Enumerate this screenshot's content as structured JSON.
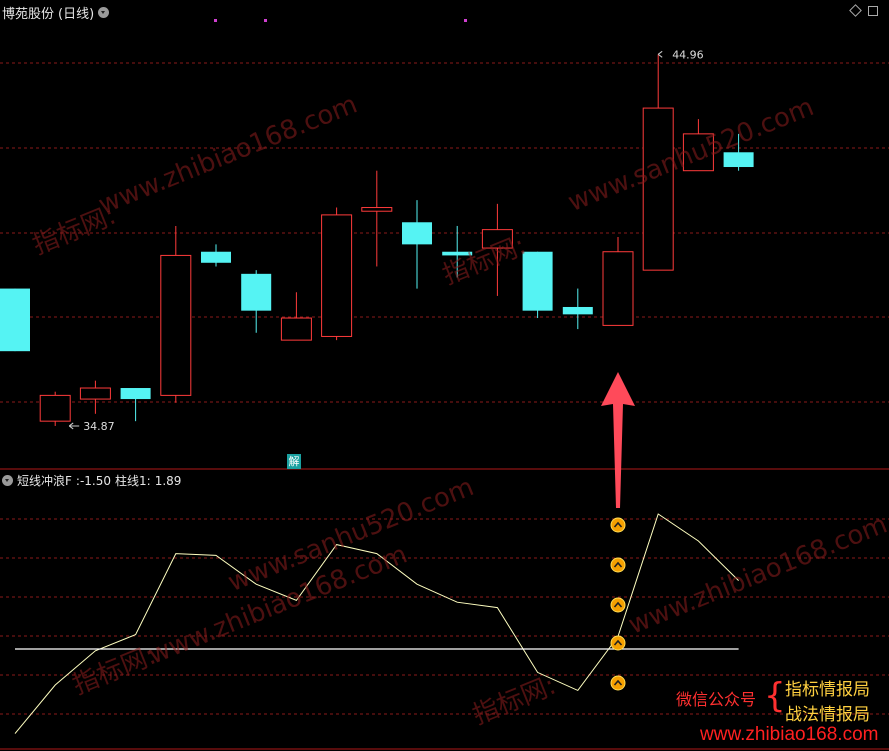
{
  "header": {
    "stock_name": "博苑股份",
    "period": "(日线)"
  },
  "indicator": {
    "label": "短线冲浪F",
    "value_text": ":-1.50",
    "bar_label": "柱线1:",
    "bar_value": "1.89"
  },
  "markers": {
    "high": "44.96",
    "low": "34.87",
    "jie": "解"
  },
  "watermark": {
    "cn": "指标网:",
    "url": "www.zhibiao168.com",
    "alt_url": "www.sanhu520.com"
  },
  "footer": {
    "wechat_label": "微信公众号",
    "brand1": "指标情报局",
    "brand2": "战法情报局",
    "site": "www.zhibiao168.com"
  },
  "colors": {
    "up": "#ff3b3b",
    "down": "#55f3f3",
    "grid": "#8a1a1a",
    "line": "#ffffc0",
    "baseline": "#ffffff"
  },
  "chart_data": {
    "type": "candlestick",
    "candles": [
      {
        "o": 38.6,
        "h": 38.6,
        "l": 36.9,
        "c": 36.9
      },
      {
        "o": 35.0,
        "h": 35.8,
        "l": 34.87,
        "c": 35.7
      },
      {
        "o": 35.6,
        "h": 36.1,
        "l": 35.2,
        "c": 35.9
      },
      {
        "o": 35.9,
        "h": 35.9,
        "l": 35.0,
        "c": 35.6
      },
      {
        "o": 35.7,
        "h": 40.3,
        "l": 35.5,
        "c": 39.5
      },
      {
        "o": 39.6,
        "h": 39.8,
        "l": 39.2,
        "c": 39.3
      },
      {
        "o": 39.0,
        "h": 39.1,
        "l": 37.4,
        "c": 38.0
      },
      {
        "o": 37.2,
        "h": 38.5,
        "l": 37.2,
        "c": 37.8
      },
      {
        "o": 37.3,
        "h": 40.8,
        "l": 37.2,
        "c": 40.6
      },
      {
        "o": 40.7,
        "h": 41.8,
        "l": 39.2,
        "c": 40.8
      },
      {
        "o": 40.4,
        "h": 41.0,
        "l": 38.6,
        "c": 39.8
      },
      {
        "o": 39.6,
        "h": 40.3,
        "l": 38.9,
        "c": 39.5
      },
      {
        "o": 39.7,
        "h": 40.9,
        "l": 38.4,
        "c": 40.2
      },
      {
        "o": 39.6,
        "h": 39.6,
        "l": 37.8,
        "c": 38.0
      },
      {
        "o": 38.1,
        "h": 38.6,
        "l": 37.5,
        "c": 37.9
      },
      {
        "o": 37.6,
        "h": 40.0,
        "l": 37.6,
        "c": 39.6
      },
      {
        "o": 39.1,
        "h": 44.96,
        "l": 39.1,
        "c": 43.5
      },
      {
        "o": 41.8,
        "h": 43.2,
        "l": 41.8,
        "c": 42.8
      },
      {
        "o": 42.3,
        "h": 42.8,
        "l": 41.8,
        "c": 41.9
      }
    ],
    "indicator_series": [
      -6.2,
      -3.5,
      -1.6,
      -0.7,
      3.8,
      3.7,
      2.1,
      1.2,
      4.3,
      3.8,
      2.1,
      1.1,
      0.8,
      -2.8,
      -3.8,
      -0.8,
      6.0,
      4.5,
      2.3
    ],
    "indicator_baseline": -1.5,
    "signal_columns": [
      15
    ],
    "y_range": [
      34.0,
      46.0
    ],
    "indicator_range": [
      -7.0,
      8.0
    ]
  }
}
